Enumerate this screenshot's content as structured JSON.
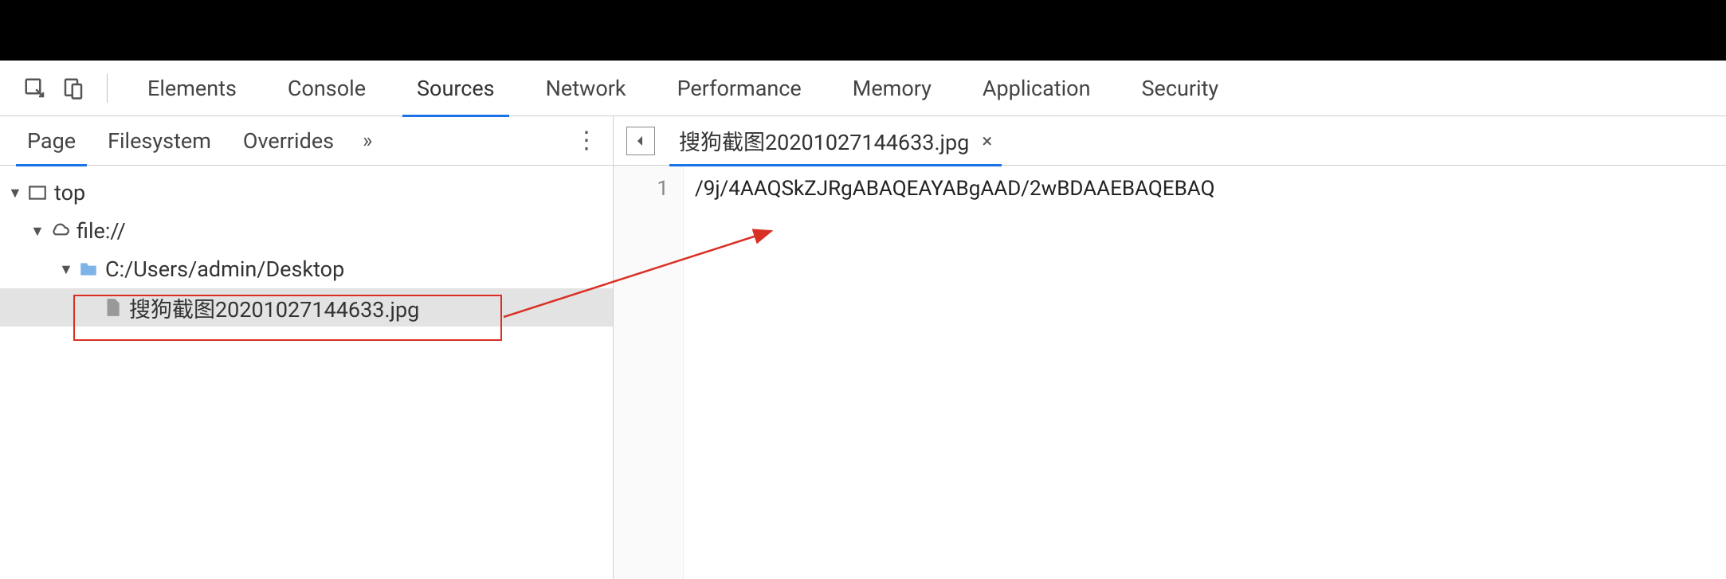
{
  "tabs": {
    "elements": "Elements",
    "console": "Console",
    "sources": "Sources",
    "network": "Network",
    "performance": "Performance",
    "memory": "Memory",
    "application": "Application",
    "security": "Security"
  },
  "navigator": {
    "page": "Page",
    "filesystem": "Filesystem",
    "overrides": "Overrides",
    "overflow": "»"
  },
  "tree": {
    "top": "top",
    "file_protocol": "file://",
    "desktop_path": "C:/Users/admin/Desktop",
    "selected_file": "搜狗截图20201027144633.jpg"
  },
  "editor": {
    "tab_name": "搜狗截图20201027144633.jpg",
    "line_number": "1",
    "code_line": "/9j/4AAQSkZJRgABAQEAYABgAAD/2wBDAAEBAQEBAQ"
  }
}
